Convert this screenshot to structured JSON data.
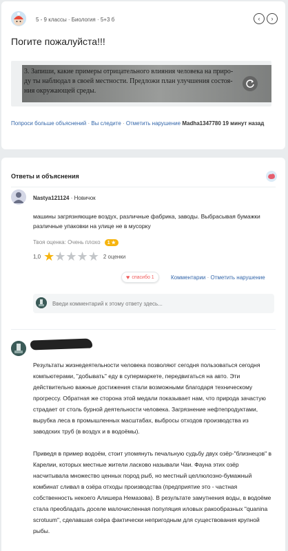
{
  "question": {
    "meta": "5 - 9 классы · Биология · 5+3 б",
    "title": "Погите пожалуйста!!!",
    "image_lines": [
      "3. Запиши, какие примеры отрицательного влияния человека на приро-",
      "ду ты наблюдал в своей местности. Предложи план улучшения состоя-",
      "ния окружающей среды."
    ],
    "links": {
      "more_explanations": "Попроси больше объяснений",
      "following": "Вы следите",
      "report": "Отметить нарушение"
    },
    "author": "Madha1347780",
    "time": "19 минут назад"
  },
  "answers": {
    "header": "Ответы и объяснения",
    "first": {
      "author": "Nastya121124",
      "rank": "· Новичок",
      "text": "машины загрязняющие воздух, различные фабрика, заводы. Выбрасывая бумажки различные упаковки на улице не в мусорку",
      "your_rating_label": "Твоя оценка: Очень плохо",
      "your_rating_badge": "1 ★",
      "rating_value": "1,0",
      "ratings_count": "2 оценки",
      "rating_stars": 1,
      "thanks_label": "спасибо 1",
      "comments_link": "Комментарии",
      "report_link": "Отметить нарушение",
      "comment_placeholder": "Введи комментарий к этому ответу здесь..."
    },
    "second": {
      "paragraph1": "Результаты жизнедеятельности человека позволяют сегодня пользоваться сегодня компьютерами, \"добывать\" еду в супермаркете, передвигаться на авто. Эти действительно важные достижения стали возможными благодаря техническому прогрессу. Обратная же сторона этой медали показывает нам, что природа зачастую страдает от столь бурной деятельности человека. Загрязнение нефтепродуктами, вырубка леса в промышленных масштабах, выбросы отходов производства из заводских труб (в воздух и в водоёмы).",
      "paragraph2": "Приведя в пример водоём, стоит упомянуть печальную судьбу двух озёр-\"близнецов\" в Карелии, которых местные жители ласково называли Чаи. Фауна этих озёр насчитывала множество ценных пород рыб, но местный целлюлозно-бумажный комбинат сливал в озёра отходы производства (предприятие это - частная собственность некоего Алишера Немазова). В результате замутнения воды, в водоёме стала преобладать доселе малочисленная популяция иловых ракообразных \"quanina scrotuum\", сделавшая озёра фактически непригодным для существования крупной рыбы."
    }
  },
  "colors": {
    "link": "#3366aa",
    "star_on": "#f6b40e",
    "star_off": "#c3c6c9",
    "thanks_heart": "#f05a5a"
  }
}
